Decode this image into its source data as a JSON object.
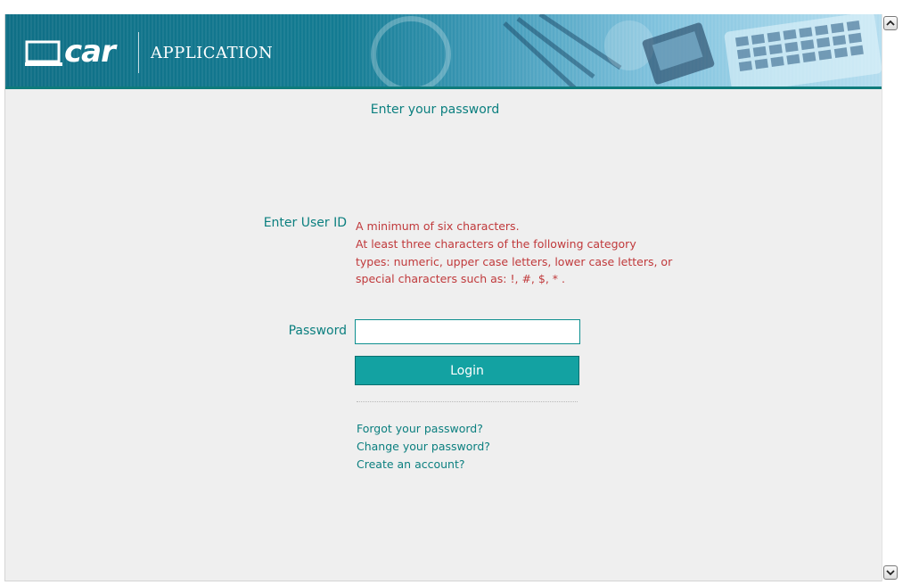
{
  "header": {
    "logo_text": "car",
    "app_label": "APPLICATION",
    "colors": {
      "banner": "#137b92",
      "banner_rule": "#0e7b7b"
    }
  },
  "page": {
    "heading": "Enter your password"
  },
  "form": {
    "user_id_label": "Enter User ID",
    "rules": [
      "A minimum of six characters.",
      "At least three characters of the following category",
      "types: numeric, upper case letters, lower case letters, or",
      "special characters such as: !, #, $, * ."
    ],
    "password_label": "Password",
    "password_value": "",
    "login_label": "Login"
  },
  "links": {
    "forgot": "Forgot your password?",
    "change": "Change your password?",
    "create": "Create an account?"
  },
  "colors": {
    "accent_text": "#0b7f7f",
    "rule_text": "#c0393b",
    "button_bg": "#13a2a2",
    "page_bg": "#efefef"
  },
  "scrollbar": {
    "up_icon": "chevron-up-icon",
    "down_icon": "chevron-down-icon"
  }
}
